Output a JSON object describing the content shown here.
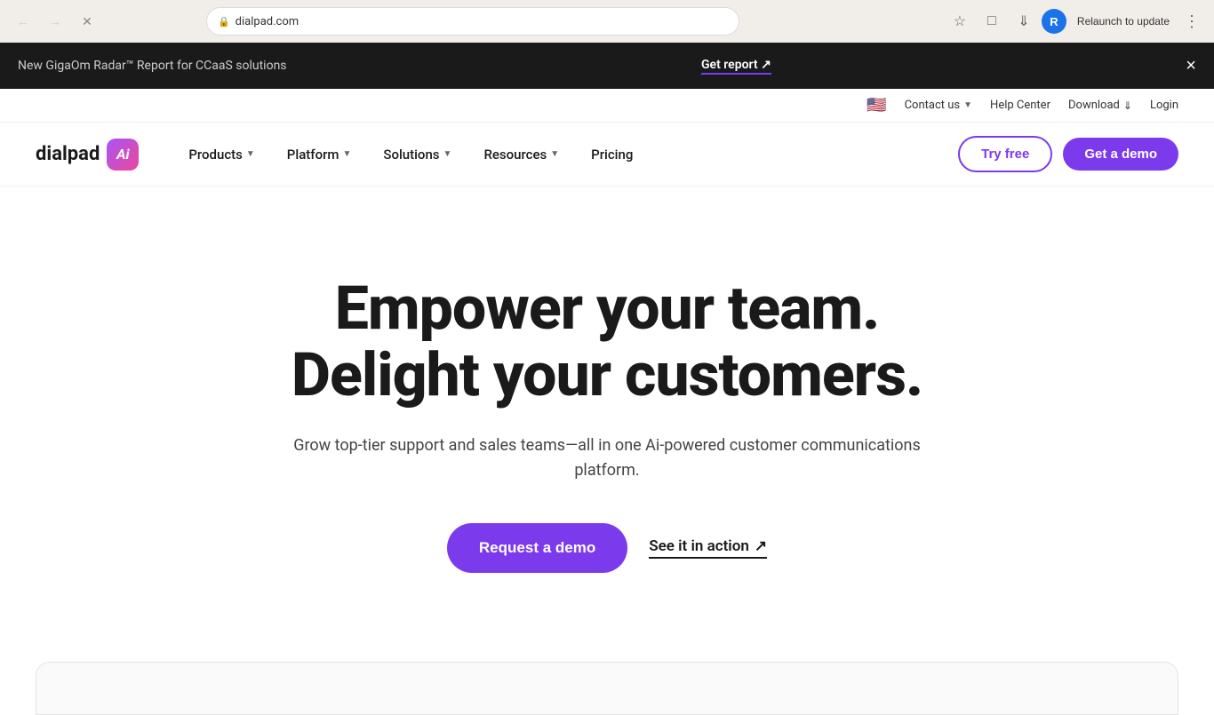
{
  "browser": {
    "url": "dialpad.com",
    "back_disabled": true,
    "forward_disabled": true,
    "profile_initial": "R",
    "relaunch_label": "Relaunch to update",
    "menu_label": "⋮"
  },
  "announcement": {
    "text": "New GigaOm Radar™ Report for CCaaS solutions",
    "link_label": "Get report ↗",
    "close_label": "×"
  },
  "utility_bar": {
    "flag": "🇺🇸",
    "contact_label": "Contact us",
    "help_label": "Help Center",
    "download_label": "Download",
    "login_label": "Login"
  },
  "nav": {
    "logo_text": "dialpad",
    "logo_badge": "Ai",
    "items": [
      {
        "label": "Products",
        "has_dropdown": true
      },
      {
        "label": "Platform",
        "has_dropdown": true
      },
      {
        "label": "Solutions",
        "has_dropdown": true
      },
      {
        "label": "Resources",
        "has_dropdown": true
      },
      {
        "label": "Pricing",
        "has_dropdown": false
      }
    ],
    "try_free_label": "Try free",
    "get_demo_label": "Get a demo"
  },
  "hero": {
    "headline_line1": "Empower your team.",
    "headline_line2": "Delight your customers.",
    "subtext": "Grow top-tier support and sales teams—all in one Ai-powered customer communications platform.",
    "request_demo_label": "Request a demo",
    "see_action_label": "See it in action",
    "see_action_arrow": "↗"
  }
}
